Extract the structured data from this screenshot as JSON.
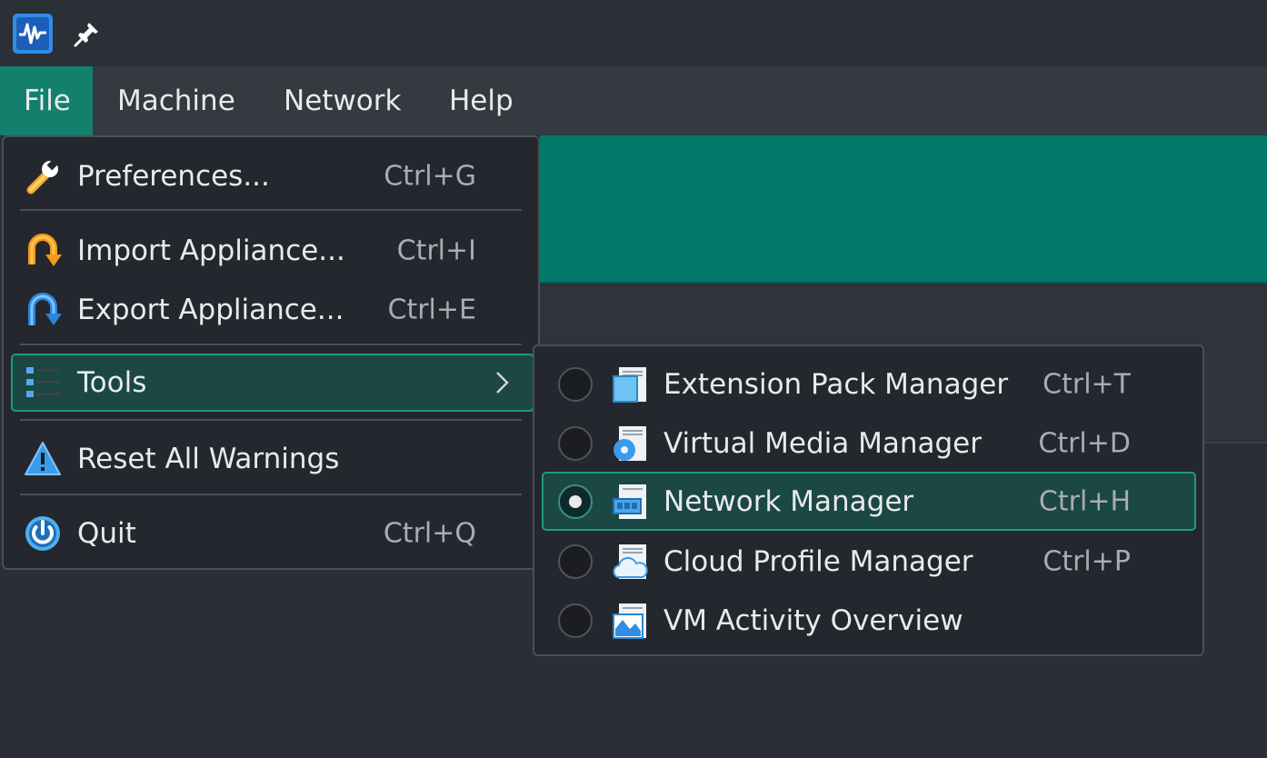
{
  "menubar": {
    "items": [
      {
        "label": "File",
        "active": true
      },
      {
        "label": "Machine"
      },
      {
        "label": "Network"
      },
      {
        "label": "Help"
      }
    ]
  },
  "file_menu": {
    "preferences": {
      "label": "Preferences...",
      "shortcut": "Ctrl+G",
      "icon": "wrench-icon"
    },
    "import": {
      "label": "Import Appliance...",
      "shortcut": "Ctrl+I",
      "icon": "import-appliance-icon"
    },
    "export": {
      "label": "Export Appliance...",
      "shortcut": "Ctrl+E",
      "icon": "export-appliance-icon"
    },
    "tools": {
      "label": "Tools",
      "icon": "tools-list-icon",
      "highlighted": true
    },
    "reset_warnings": {
      "label": "Reset All Warnings",
      "icon": "warning-icon"
    },
    "quit": {
      "label": "Quit",
      "shortcut": "Ctrl+Q",
      "icon": "power-icon"
    }
  },
  "tools_menu": {
    "items": [
      {
        "label": "Extension Pack Manager",
        "shortcut": "Ctrl+T",
        "checked": false,
        "icon": "extension-pack-icon"
      },
      {
        "label": "Virtual Media Manager",
        "shortcut": "Ctrl+D",
        "checked": false,
        "icon": "virtual-media-icon"
      },
      {
        "label": "Network Manager",
        "shortcut": "Ctrl+H",
        "checked": true,
        "icon": "network-manager-icon"
      },
      {
        "label": "Cloud Profile Manager",
        "shortcut": "Ctrl+P",
        "checked": false,
        "icon": "cloud-profile-icon"
      },
      {
        "label": "VM Activity Overview",
        "shortcut": "",
        "checked": false,
        "icon": "activity-overview-icon"
      }
    ]
  },
  "colors": {
    "accent": "#13806e",
    "banner": "#00786a",
    "highlight_bg": "#1b4744",
    "highlight_border": "#1b9a84"
  }
}
